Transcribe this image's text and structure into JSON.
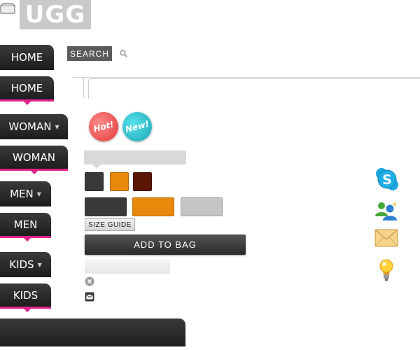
{
  "logo": {
    "text": "UGG"
  },
  "search": {
    "label": "SEARCH"
  },
  "nav": {
    "items": [
      {
        "label": "HOME",
        "has_arrow": false,
        "active": false
      },
      {
        "label": "HOME",
        "has_arrow": false,
        "active": true
      },
      {
        "label": "WOMAN",
        "has_arrow": true,
        "active": false
      },
      {
        "label": "WOMAN",
        "has_arrow": false,
        "active": true
      },
      {
        "label": "MEN",
        "has_arrow": true,
        "active": false
      },
      {
        "label": "MEN",
        "has_arrow": false,
        "active": true
      },
      {
        "label": "KIDS",
        "has_arrow": true,
        "active": false
      },
      {
        "label": "KIDS",
        "has_arrow": false,
        "active": true
      }
    ],
    "arrow_glyph": "▼"
  },
  "badges": {
    "hot": "Hot!",
    "new": "New!"
  },
  "swatches": {
    "small": [
      "#3a3a3a",
      "#e8890c",
      "#5a1706"
    ],
    "large": [
      "#3a3a3a",
      "#e8890c",
      "#c4c4c4"
    ]
  },
  "product": {
    "size_guide_label": "SIZE GUIDE",
    "add_to_bag_label": "ADD TO BAG"
  },
  "colors": {
    "accent": "#e0218a",
    "nav_bg": "#2a2a2a"
  },
  "right_icons": [
    "skype-icon",
    "messenger-icon",
    "envelope-icon",
    "lightbulb-icon"
  ]
}
